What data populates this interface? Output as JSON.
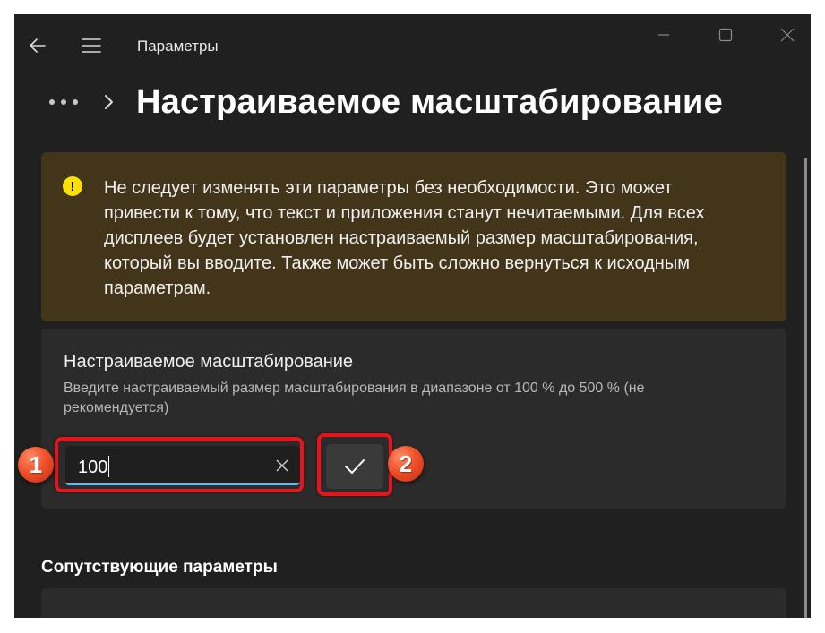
{
  "window": {
    "app_title": "Параметры"
  },
  "breadcrumb": {
    "page_title": "Настраиваемое масштабирование"
  },
  "warning": {
    "icon": "!",
    "text": "Не следует изменять эти параметры без необходимости. Это может привести к тому, что текст и приложения станут нечитаемыми. Для всех дисплеев будет установлен настраиваемый размер масштабирования, который вы вводите. Также может быть сложно вернуться к исходным параметрам."
  },
  "scaling_card": {
    "title": "Настраиваемое масштабирование",
    "description": "Введите настраиваемый размер масштабирования в диапазоне от 100 % до 500 % (не рекомендуется)",
    "input_value": "100"
  },
  "annotations": {
    "badge_1": "1",
    "badge_2": "2",
    "highlight_color": "#e8141c"
  },
  "related": {
    "heading": "Сопутствующие параметры"
  },
  "colors": {
    "background": "#202020",
    "card": "#2b2b2b",
    "warning_bg": "#433519",
    "warning_icon": "#fce100",
    "accent": "#4cc2ff"
  },
  "icons": {
    "back": "back-arrow-icon",
    "menu": "hamburger-menu-icon",
    "minimize": "minimize-icon",
    "maximize": "maximize-icon",
    "close": "close-icon",
    "more": "more-dots-icon",
    "chevron": "chevron-right-icon",
    "warning": "warning-icon",
    "clear": "clear-x-icon",
    "apply": "checkmark-icon"
  }
}
